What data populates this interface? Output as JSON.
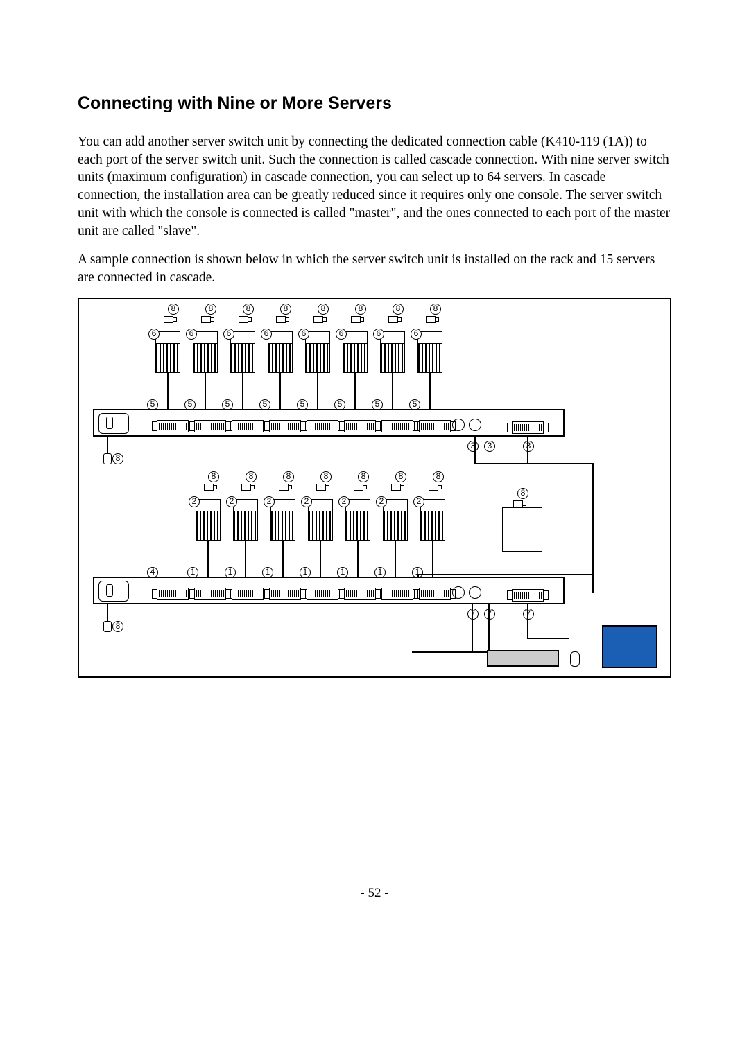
{
  "heading": "Connecting with Nine or More Servers",
  "para1": "You can add another server switch unit by connecting the dedicated connection cable (K410-119 (1A)) to each port of the server switch unit.    Such the connection is called cascade connection.    With nine server switch units (maximum configuration) in cascade connection, you can select up to 64 servers. In cascade connection, the installation area can be greatly reduced since it requires only one console. The server switch unit with which the console is connected is called \"master\", and the ones connected to each port of the master unit are called \"slave\".",
  "para2": "A sample connection is shown below in which the server switch unit is installed on the rack and 15 servers are connected in cascade.",
  "page_number": "- 52 -",
  "labels": {
    "n1": "1",
    "n2": "2",
    "n3": "3",
    "n4": "4",
    "n5": "5",
    "n6": "6",
    "n7": "7",
    "n8": "8"
  }
}
